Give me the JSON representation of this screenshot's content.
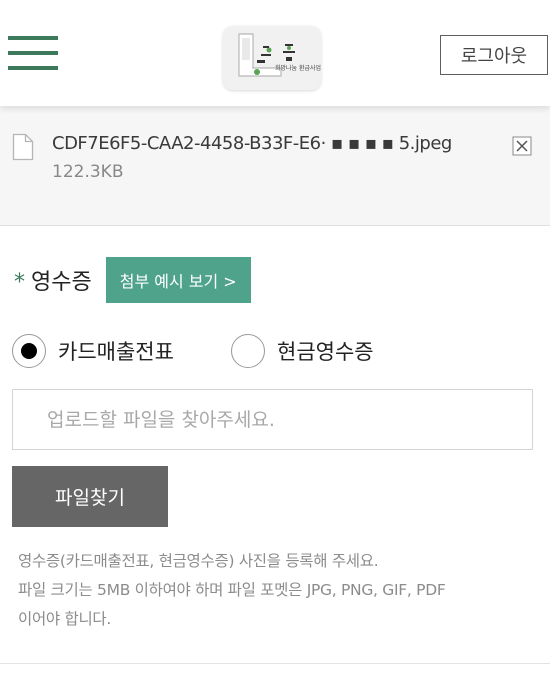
{
  "header": {
    "logout_label": "로그아웃",
    "logo_text": "희망나눔 환급사업",
    "accent_color": "#3c7a5b"
  },
  "attachment": {
    "file_name": "CDF7E6F5-CAA2-4458-B33F-E6·  ▪ ▪ ▪ ▪ 5.jpeg",
    "file_size": "122.3KB",
    "icon": "file-icon",
    "remove_icon": "close-icon"
  },
  "receipt": {
    "required_mark": "*",
    "label": "영수증",
    "example_button": "첨부 예시 보기 >",
    "example_color": "#4fa38b",
    "options": [
      {
        "label": "카드매출전표",
        "checked": true
      },
      {
        "label": "현금영수증",
        "checked": false
      }
    ],
    "upload_placeholder": "업로드할 파일을 찾아주세요.",
    "find_button": "파일찾기",
    "help_lines": [
      "영수증(카드매출전표, 현금영수증) 사진을 등록해 주세요.",
      "파일 크기는 5MB 이하여야 하며 파일 포멧은 JPG, PNG, GIF, PDF",
      "이어야 합니다."
    ]
  }
}
